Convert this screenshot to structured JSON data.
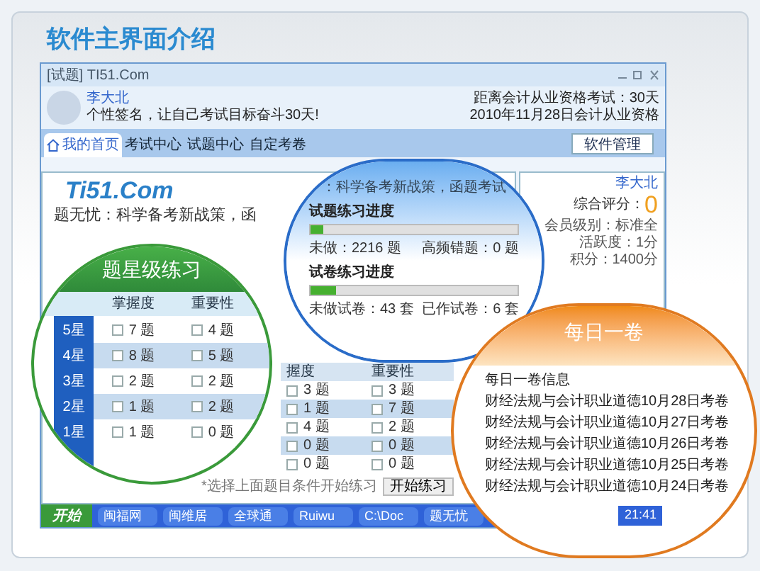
{
  "page_title": "软件主界面介绍",
  "app": {
    "title": "[试题] TI51.Com",
    "profile": {
      "name": "李大北",
      "signature": "个性签名，让自己考试目标奋斗30天!"
    },
    "countdown": [
      "距离会计从业资格考试：30天",
      "2010年11月28日会计从业资格"
    ],
    "tabs": [
      {
        "label": "我的首页",
        "selected": true
      },
      {
        "label": "考试中心",
        "selected": false
      },
      {
        "label": "试题中心",
        "selected": false
      },
      {
        "label": "自定考卷",
        "selected": false
      }
    ],
    "manage_button": "软件管理",
    "logo": "Ti51.Com",
    "slogan": "题无忧：科学备考新战策，函",
    "table": {
      "columns": [
        "握度",
        "重要性"
      ],
      "rows": [
        [
          "3 题",
          "3 题"
        ],
        [
          "1 题",
          "7 题"
        ],
        [
          "4 题",
          "2 题"
        ],
        [
          "0 题",
          "0 题"
        ],
        [
          "0 题",
          "0 题"
        ]
      ]
    },
    "hint": "*选择上面题目条件开始练习",
    "start_button": "开始练习",
    "side": {
      "name": "李大北",
      "score_label": "综合评分：",
      "score": "0",
      "lines": [
        "会员级别：标准全",
        "活跃度：1分",
        "积分：1400分"
      ]
    },
    "taskbar": {
      "start": "开始",
      "items": [
        "闽福网",
        "闽维居",
        "全球通",
        "Ruiwu",
        "C:\\Doc",
        "题无忧"
      ],
      "clock": "21:41"
    }
  },
  "zoom_progress": {
    "slogan": "：科学备考新战策，函题考试",
    "sections": [
      {
        "title": "试题练习进度",
        "level": 0.06,
        "stats": [
          "未做：2216 题",
          "高频错题：0 题"
        ]
      },
      {
        "title": "试卷练习进度",
        "level": 0.12,
        "stats": [
          "未做试卷：43 套",
          "已作试卷：6 套"
        ]
      }
    ]
  },
  "zoom_star": {
    "title": "题星级练习",
    "columns": [
      "掌握度",
      "重要性"
    ],
    "rows": [
      {
        "label": "5星",
        "cells": [
          "7 题",
          "4 题"
        ]
      },
      {
        "label": "4星",
        "cells": [
          "8 题",
          "5 题"
        ]
      },
      {
        "label": "3星",
        "cells": [
          "2 题",
          "2 题"
        ]
      },
      {
        "label": "2星",
        "cells": [
          "1 题",
          "2 题"
        ]
      },
      {
        "label": "1星",
        "cells": [
          "1 题",
          "0 题"
        ]
      }
    ]
  },
  "zoom_daily": {
    "title": "每日一卷",
    "items": [
      "每日一卷信息",
      "财经法规与会计职业道德10月28日考卷",
      "财经法规与会计职业道德10月27日考卷",
      "财经法规与会计职业道德10月26日考卷",
      "财经法规与会计职业道德10月25日考卷",
      "财经法规与会计职业道德10月24日考卷"
    ]
  }
}
